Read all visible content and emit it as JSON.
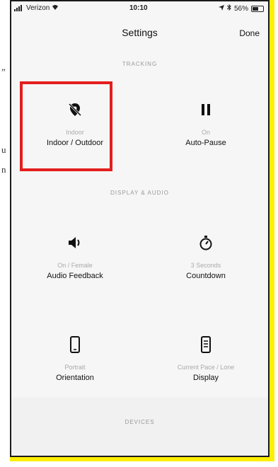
{
  "doc_fragments": [
    "”",
    "u",
    "n"
  ],
  "statusbar": {
    "carrier": "Verizon",
    "time": "10:10",
    "battery": "56%",
    "battery_level": 0.56
  },
  "nav": {
    "title": "Settings",
    "done_label": "Done"
  },
  "sections": {
    "tracking": "TRACKING",
    "display_audio": "DISPLAY & AUDIO",
    "devices": "DEVICES"
  },
  "tiles": [
    {
      "icon": "location-off-icon",
      "sub": "Indoor",
      "label": "Indoor / Outdoor"
    },
    {
      "icon": "pause-icon",
      "sub": "On",
      "label": "Auto-Pause"
    },
    {
      "icon": "speaker-icon",
      "sub": "On / Female",
      "label": "Audio Feedback"
    },
    {
      "icon": "stopwatch-icon",
      "sub": "3 Seconds",
      "label": "Countdown"
    },
    {
      "icon": "phone-portrait-icon",
      "sub": "Portrait",
      "label": "Orientation"
    },
    {
      "icon": "phone-display-icon",
      "sub": "Current Pace / Lone",
      "label": "Display"
    }
  ],
  "colors": {
    "frame": "#ffee00",
    "highlight": "#e41e1e",
    "screen_bg": "#f6f6f6"
  }
}
